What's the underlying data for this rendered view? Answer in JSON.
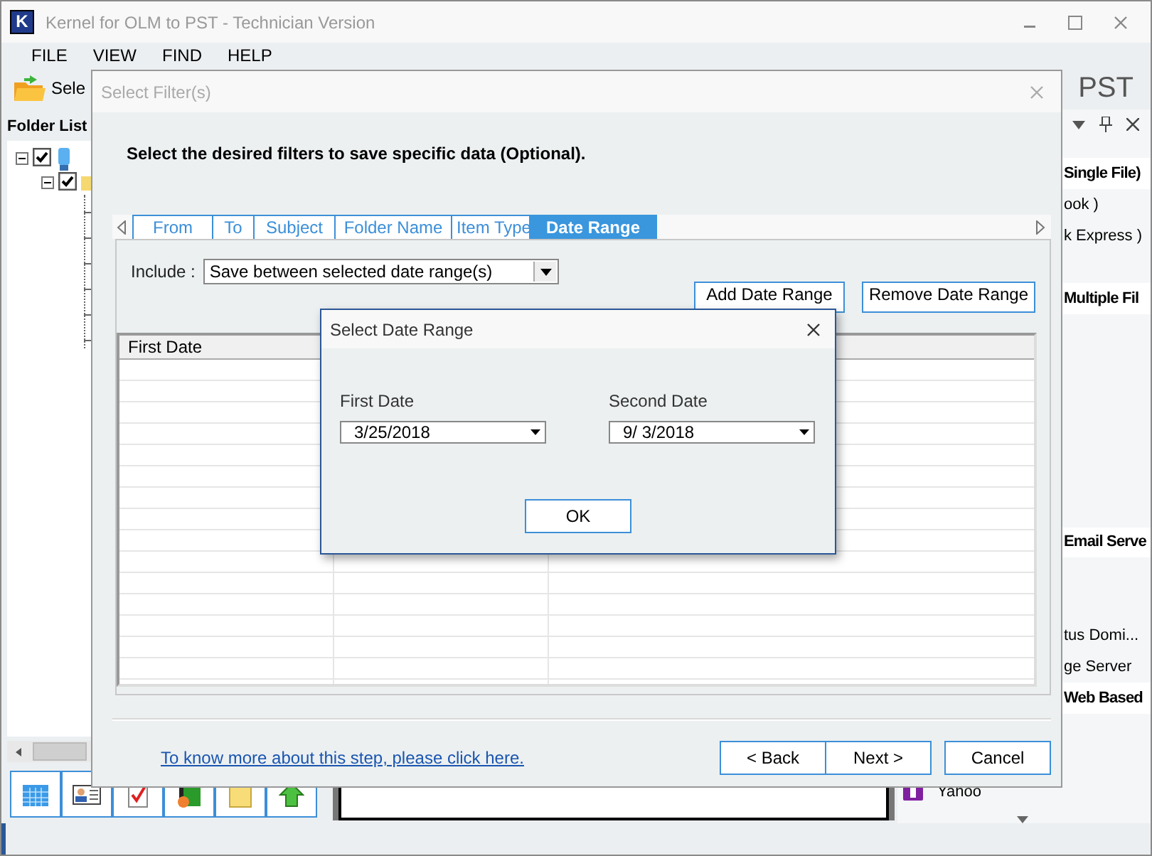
{
  "window": {
    "icon_letter": "K",
    "title": "Kernel for OLM to PST - Technician Version"
  },
  "menu": [
    "FILE",
    "VIEW",
    "FIND",
    "HELP"
  ],
  "toolbar": {
    "button": "Sele",
    "banner": "PST"
  },
  "folder_pane": {
    "title": "Folder List",
    "tree": [
      {
        "kind": "computer",
        "checked": true,
        "expanded": true,
        "children": [
          {
            "kind": "folder",
            "checked": true,
            "expanded": true
          }
        ]
      }
    ]
  },
  "view_buttons": [
    {
      "kind": "calendar"
    },
    {
      "kind": "contact"
    },
    {
      "kind": "task"
    },
    {
      "kind": "journal"
    },
    {
      "kind": "note"
    },
    {
      "kind": "upload"
    }
  ],
  "right_pane": {
    "items": [
      {
        "label": "Single File)",
        "kind": "group"
      },
      {
        "label": "ook )",
        "kind": "item"
      },
      {
        "label": "k Express )",
        "kind": "item"
      },
      {
        "label": "Multiple Fil",
        "kind": "group"
      },
      {
        "label": "Email Serve",
        "kind": "group"
      },
      {
        "label": "tus Domi...",
        "kind": "item"
      },
      {
        "label": "ge Server",
        "kind": "item"
      },
      {
        "label": "Web Based",
        "kind": "group"
      },
      {
        "label": "Yahoo",
        "kind": "service"
      }
    ]
  },
  "filter_dialog": {
    "title": "Select Filter(s)",
    "heading": "Select the desired filters to save specific data (Optional).",
    "tabs": [
      {
        "label": "From",
        "selected": false
      },
      {
        "label": "To",
        "selected": false
      },
      {
        "label": "Subject",
        "selected": false
      },
      {
        "label": "Folder Name",
        "selected": false
      },
      {
        "label": "Item Type",
        "selected": false
      },
      {
        "label": "Date Range",
        "selected": true
      }
    ],
    "include_label": "Include :",
    "include_value": "Save between selected date range(s)",
    "buttons": [
      "Add Date Range",
      "Remove Date Range"
    ],
    "columns": [
      "First Date"
    ],
    "link": "To know more about this step, please click here.",
    "nav_buttons": [
      "< Back",
      "Next >",
      "Cancel"
    ]
  },
  "date_dialog": {
    "title": "Select Date Range",
    "fields": [
      {
        "label": "First Date",
        "value": "3/25/2018"
      },
      {
        "label": "Second Date",
        "value": "9/ 3/2018"
      }
    ],
    "ok": "OK"
  }
}
